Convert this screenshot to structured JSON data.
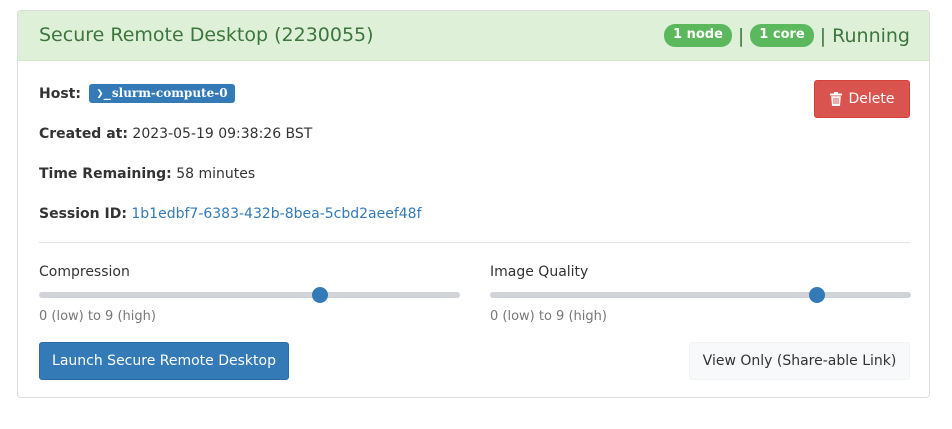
{
  "header": {
    "title": "Secure Remote Desktop (2230055)",
    "nodes_badge": "1 node",
    "cores_badge": "1 core",
    "separator": "|",
    "status": "Running"
  },
  "info": {
    "host_label": "Host:",
    "host_prompt": "❯_",
    "host_value": "slurm-compute-0",
    "created_label": "Created at:",
    "created_value": "2023-05-19 09:38:26 BST",
    "time_label": "Time Remaining:",
    "time_value": "58 minutes",
    "session_label": "Session ID:",
    "session_value": "1b1edbf7-6383-432b-8bea-5cbd2aeef48f"
  },
  "actions": {
    "delete_label": "Delete",
    "launch_label": "Launch Secure Remote Desktop",
    "view_only_label": "View Only (Share-able Link)"
  },
  "sliders": {
    "compression": {
      "label": "Compression",
      "hint": "0 (low) to 9 (high)",
      "min": 0,
      "max": 9,
      "value": 6
    },
    "quality": {
      "label": "Image Quality",
      "hint": "0 (low) to 9 (high)",
      "min": 0,
      "max": 9,
      "value": 7
    }
  },
  "colors": {
    "header_bg": "#dff0d8",
    "header_text": "#3c763d",
    "badge": "#5cb85c",
    "primary": "#337ab7",
    "danger": "#d9534f"
  }
}
